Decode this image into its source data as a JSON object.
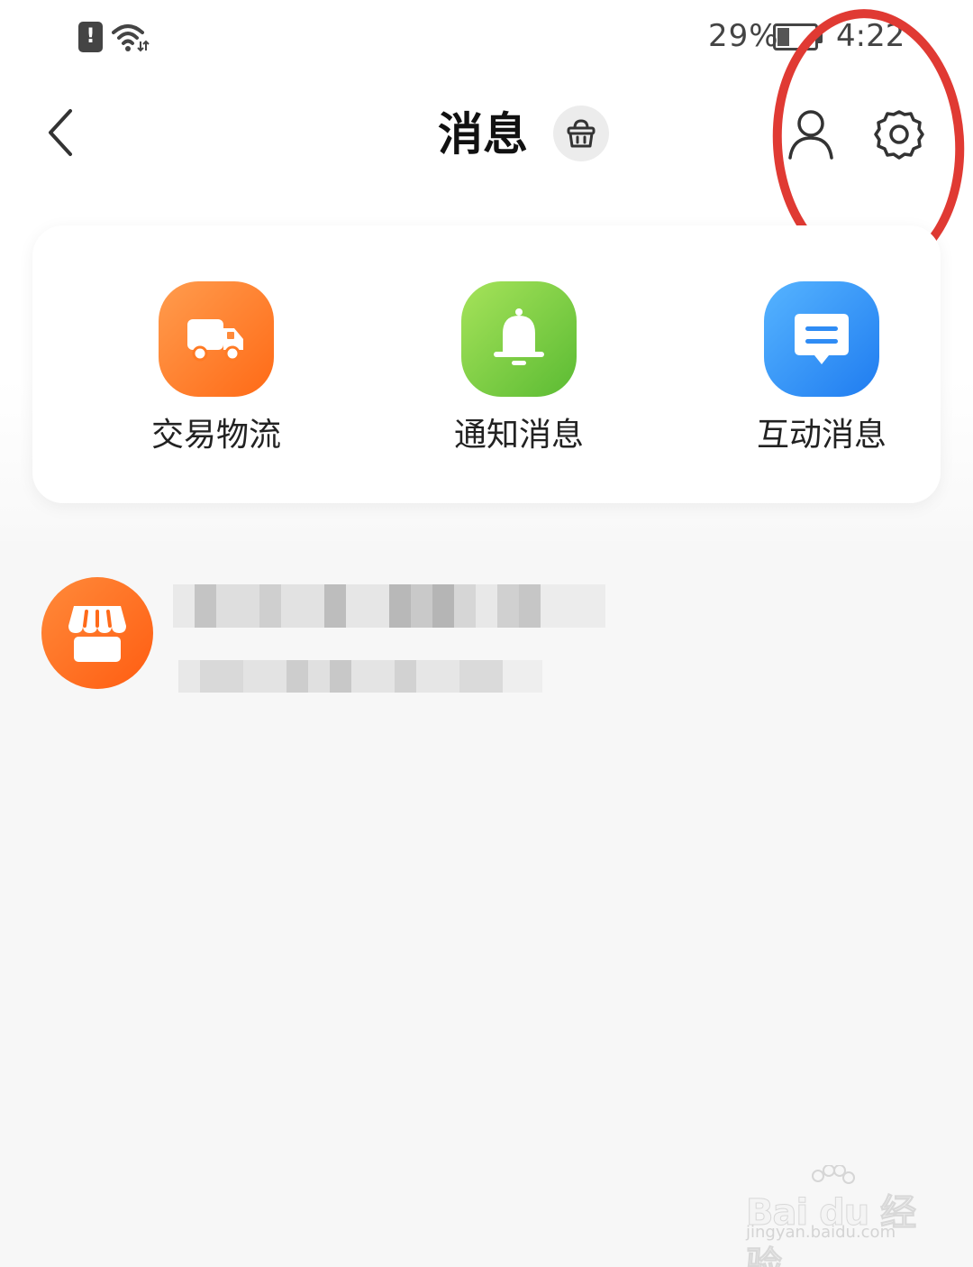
{
  "status_bar": {
    "battery_percent": "29%",
    "battery_level": 0.29,
    "time": "4:22",
    "alert_glyph": "!",
    "icons": [
      "alert-icon",
      "wifi-icon",
      "battery-icon"
    ]
  },
  "nav": {
    "title": "消息",
    "icons": [
      "back-arrow-icon",
      "basket-icon",
      "contacts-icon",
      "settings-gear-icon"
    ]
  },
  "categories": [
    {
      "label": "交易物流",
      "icon": "truck-icon",
      "color": "#ff7a24"
    },
    {
      "label": "通知消息",
      "icon": "bell-icon",
      "color": "#6cc63c"
    },
    {
      "label": "互动消息",
      "icon": "chat-message-icon",
      "color": "#2f8cf5"
    }
  ],
  "conversation": {
    "avatar_icon": "store-icon",
    "avatar_color": "#ff6a1a"
  },
  "annotation": {
    "color": "#e03a33"
  },
  "watermark": {
    "main": "Bai du 经验",
    "sub": "jingyan.baidu.com"
  }
}
